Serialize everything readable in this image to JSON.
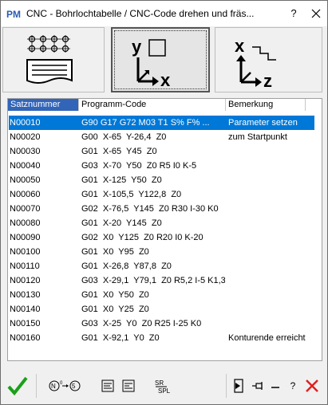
{
  "window": {
    "title": "CNC - Bohrlochtabelle / CNC-Code drehen und fräs...",
    "help_label": "?",
    "close_label": "✕"
  },
  "toolbar": {
    "buttons": [
      {
        "name": "bohrlochtabelle",
        "icon": "hole-pattern-table-icon"
      },
      {
        "name": "drehen",
        "icon": "turning-xy-axes-icon",
        "selected": true
      },
      {
        "name": "fraesen",
        "icon": "milling-xz-axes-icon"
      }
    ]
  },
  "table": {
    "columns": [
      "Satznummer",
      "Programm-Code",
      "Bemerkung"
    ],
    "rows": [
      {
        "nr": "N00010",
        "code": "G90 G17 G72 M03 T1 S% F% ...",
        "bem": "Parameter setzen",
        "selected": true
      },
      {
        "nr": "N00020",
        "code": "G00  X-65  Y-26,4  Z0",
        "bem": "zum Startpunkt"
      },
      {
        "nr": "N00030",
        "code": "G01  X-65  Y45  Z0",
        "bem": ""
      },
      {
        "nr": "N00040",
        "code": "G03  X-70  Y50  Z0 R5 I0 K-5",
        "bem": ""
      },
      {
        "nr": "N00050",
        "code": "G01  X-125  Y50  Z0",
        "bem": ""
      },
      {
        "nr": "N00060",
        "code": "G01  X-105,5  Y122,8  Z0",
        "bem": ""
      },
      {
        "nr": "N00070",
        "code": "G02  X-76,5  Y145  Z0 R30 I-30 K0",
        "bem": ""
      },
      {
        "nr": "N00080",
        "code": "G01  X-20  Y145  Z0",
        "bem": ""
      },
      {
        "nr": "N00090",
        "code": "G02  X0  Y125  Z0 R20 I0 K-20",
        "bem": ""
      },
      {
        "nr": "N00100",
        "code": "G01  X0  Y95  Z0",
        "bem": ""
      },
      {
        "nr": "N00110",
        "code": "G01  X-26,8  Y87,8  Z0",
        "bem": ""
      },
      {
        "nr": "N00120",
        "code": "G03  X-29,1  Y79,1  Z0 R5,2 I-5 K1,3",
        "bem": ""
      },
      {
        "nr": "N00130",
        "code": "G01  X0  Y50  Z0",
        "bem": ""
      },
      {
        "nr": "N00140",
        "code": "G01  X0  Y25  Z0",
        "bem": ""
      },
      {
        "nr": "N00150",
        "code": "G03  X-25  Y0  Z0 R25 I-25 K0",
        "bem": ""
      },
      {
        "nr": "N00160",
        "code": "G01  X-92,1  Y0  Z0",
        "bem": "Konturende erreicht"
      }
    ]
  },
  "bottom": {
    "buttons": [
      {
        "name": "ok",
        "icon": "green-check-icon"
      },
      {
        "name": "renumber",
        "icon": "renumber-n-icon"
      },
      {
        "name": "edit-list",
        "icon": "edit-list-icon"
      },
      {
        "name": "edit-list-2",
        "icon": "edit-list-alt-icon"
      },
      {
        "name": "code-format",
        "icon": "code-format-icon"
      },
      {
        "name": "export",
        "icon": "export-door-icon"
      },
      {
        "name": "pin",
        "icon": "pin-icon"
      },
      {
        "name": "minimize",
        "icon": "minimize-icon"
      },
      {
        "name": "help",
        "icon": "help-icon"
      },
      {
        "name": "cancel",
        "icon": "red-x-icon"
      }
    ],
    "help_label": "?"
  },
  "colors": {
    "selection": "#0078d7",
    "header_first": "#3264b8",
    "ok_green": "#1aa01a",
    "cancel_red": "#e02020"
  }
}
